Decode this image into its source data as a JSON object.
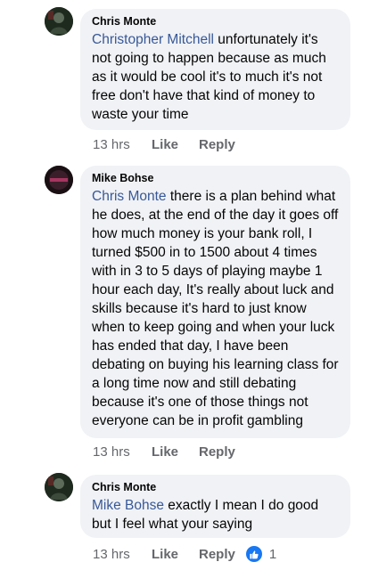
{
  "comments": [
    {
      "author": "Chris Monte",
      "mention": "Christopher Mitchell",
      "text": " unfortunately it's not going to happen because as much as it would be cool it's to much it's not free don't have that kind of money to waste your time",
      "time": "13 hrs",
      "like": "Like",
      "reply": "Reply"
    },
    {
      "author": "Mike Bohse",
      "mention": "Chris Monte",
      "text": " there is a plan behind what he does,  at the end of the day it goes off how much money is your bank roll,      I turned $500 in to 1500 about 4 times with in 3 to 5 days of playing maybe 1 hour each day,   It's really about luck and skills because it's hard to just know when to keep going and when your luck has ended that day,     I have been debating on buying his learning class for a long time now and still debating because it's one of those things not everyone can be in profit gambling",
      "time": "13 hrs",
      "like": "Like",
      "reply": "Reply"
    },
    {
      "author": "Chris Monte",
      "mention": "Mike Bohse",
      "text": " exactly I mean I do good but I feel what your saying",
      "time": "13 hrs",
      "like": "Like",
      "reply": "Reply",
      "reaction_count": "1",
      "reaction_icon": "thumbs-up-icon"
    }
  ],
  "colors": {
    "bubble": "#f0f2f5",
    "mention": "#385898",
    "meta": "#65676b",
    "like_badge": "#1877f2"
  }
}
